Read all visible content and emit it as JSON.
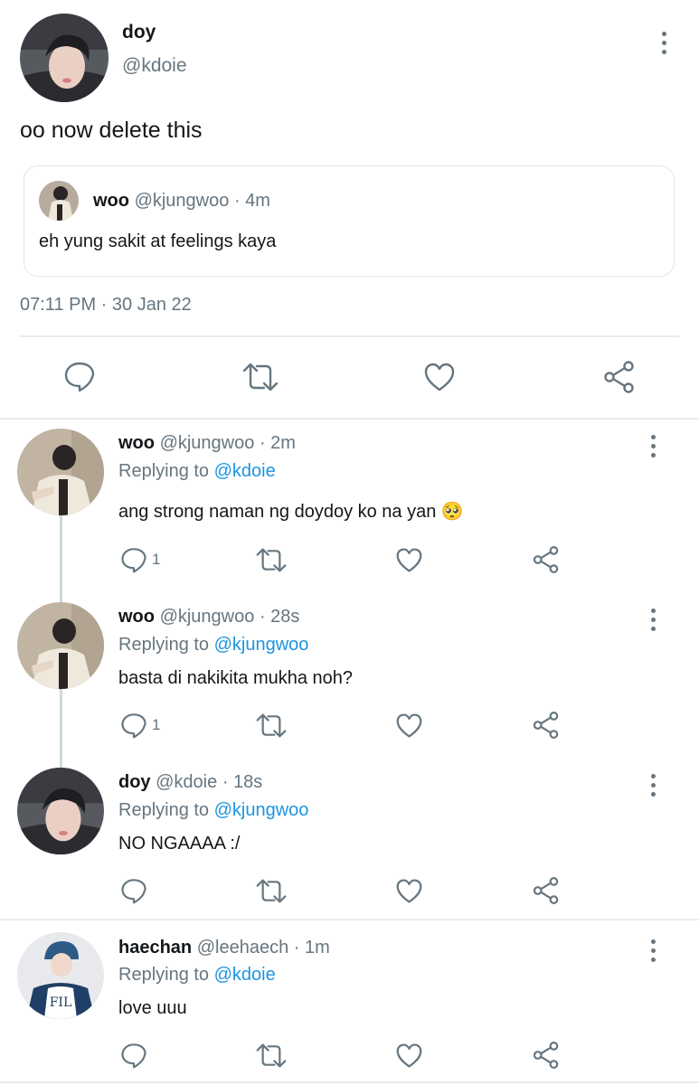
{
  "main_tweet": {
    "author_name": "doy",
    "author_handle": "@kdoie",
    "text": "oo now delete this",
    "quoted": {
      "author_name": "woo",
      "author_handle": "@kjungwoo",
      "age": "· 4m",
      "text": "eh yung sakit at feelings kaya"
    },
    "timestamp": "07:11 PM · 30 Jan 22"
  },
  "replies": [
    {
      "author_name": "woo",
      "author_handle": "@kjungwoo",
      "age": "· 2m",
      "replying_label": "Replying to",
      "replying_to": "@kdoie",
      "text": "ang strong naman ng doydoy ko na yan 🥺",
      "reply_count": "1"
    },
    {
      "author_name": "woo",
      "author_handle": "@kjungwoo",
      "age": "· 28s",
      "replying_label": "Replying to",
      "replying_to": "@kjungwoo",
      "text": "basta di nakikita mukha noh?",
      "reply_count": "1"
    },
    {
      "author_name": "doy",
      "author_handle": "@kdoie",
      "age": "· 18s",
      "replying_label": "Replying to",
      "replying_to": "@kjungwoo",
      "text": "NO NGAAAA :/",
      "reply_count": ""
    },
    {
      "author_name": "haechan",
      "author_handle": "@leehaech",
      "age": "· 1m",
      "replying_label": "Replying to",
      "replying_to": "@kdoie",
      "text": "love uuu",
      "reply_count": "",
      "avatar_text": "FIL"
    }
  ],
  "icons": {
    "reply": "reply-icon",
    "retweet": "retweet-icon",
    "like": "heart-icon",
    "share": "share-icon",
    "more": "more-vertical-icon"
  },
  "colors": {
    "link_blue": "#1b95e0",
    "secondary_gray": "#66757f",
    "divider": "#e6ecf0"
  }
}
